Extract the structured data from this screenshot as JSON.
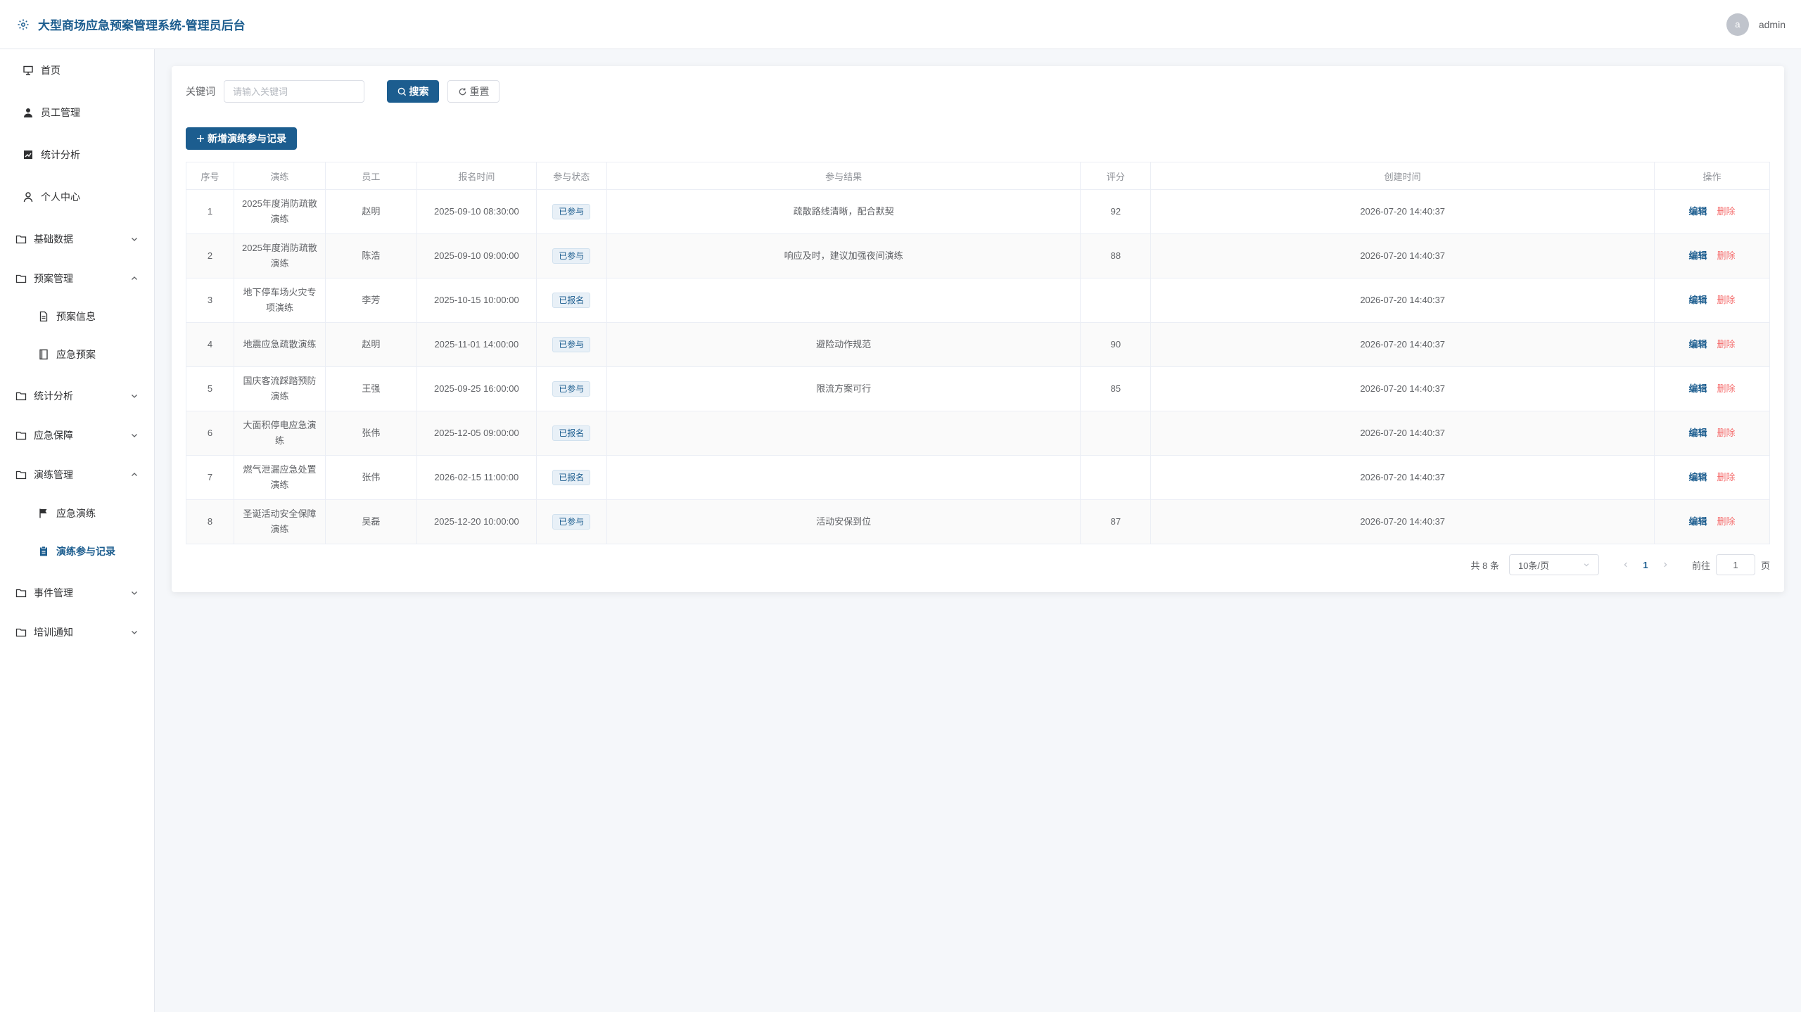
{
  "header": {
    "title": "大型商场应急预案管理系统-管理员后台",
    "avatar_letter": "a",
    "username": "admin"
  },
  "sidebar": {
    "items": [
      {
        "label": "首页",
        "icon": "presentation-icon",
        "type": "item"
      },
      {
        "label": "员工管理",
        "icon": "user-filled-icon",
        "type": "item"
      },
      {
        "label": "统计分析",
        "icon": "chart-icon",
        "type": "item"
      },
      {
        "label": "个人中心",
        "icon": "user-icon",
        "type": "item"
      },
      {
        "label": "基础数据",
        "icon": "folder-icon",
        "type": "group",
        "expanded": false
      },
      {
        "label": "预案管理",
        "icon": "folder-icon",
        "type": "group",
        "expanded": true
      },
      {
        "label": "预案信息",
        "icon": "document-icon",
        "type": "sub"
      },
      {
        "label": "应急预案",
        "icon": "notebook-icon",
        "type": "sub"
      },
      {
        "label": "统计分析",
        "icon": "folder-icon",
        "type": "group",
        "expanded": false
      },
      {
        "label": "应急保障",
        "icon": "folder-icon",
        "type": "group",
        "expanded": false
      },
      {
        "label": "演练管理",
        "icon": "folder-icon",
        "type": "group",
        "expanded": true
      },
      {
        "label": "应急演练",
        "icon": "flag-icon",
        "type": "sub"
      },
      {
        "label": "演练参与记录",
        "icon": "clipboard-icon",
        "type": "sub",
        "active": true
      },
      {
        "label": "事件管理",
        "icon": "folder-icon",
        "type": "group",
        "expanded": false
      },
      {
        "label": "培训通知",
        "icon": "folder-icon",
        "type": "group",
        "expanded": false
      }
    ]
  },
  "search": {
    "label": "关键词",
    "placeholder": "请输入关键词",
    "search_button": "搜索",
    "reset_button": "重置"
  },
  "toolbar": {
    "add_button": "新增演练参与记录"
  },
  "table": {
    "columns": [
      "序号",
      "演练",
      "员工",
      "报名时间",
      "参与状态",
      "参与结果",
      "评分",
      "创建时间",
      "操作"
    ],
    "rows": [
      {
        "no": "1",
        "drill": "2025年度消防疏散演练",
        "employee": "赵明",
        "signup_time": "2025-09-10 08:30:00",
        "status": "已参与",
        "result": "疏散路线清晰，配合默契",
        "score": "92",
        "created": "2026-07-20 14:40:37"
      },
      {
        "no": "2",
        "drill": "2025年度消防疏散演练",
        "employee": "陈浩",
        "signup_time": "2025-09-10 09:00:00",
        "status": "已参与",
        "result": "响应及时，建议加强夜间演练",
        "score": "88",
        "created": "2026-07-20 14:40:37"
      },
      {
        "no": "3",
        "drill": "地下停车场火灾专项演练",
        "employee": "李芳",
        "signup_time": "2025-10-15 10:00:00",
        "status": "已报名",
        "result": "",
        "score": "",
        "created": "2026-07-20 14:40:37"
      },
      {
        "no": "4",
        "drill": "地震应急疏散演练",
        "employee": "赵明",
        "signup_time": "2025-11-01 14:00:00",
        "status": "已参与",
        "result": "避险动作规范",
        "score": "90",
        "created": "2026-07-20 14:40:37"
      },
      {
        "no": "5",
        "drill": "国庆客流踩踏预防演练",
        "employee": "王强",
        "signup_time": "2025-09-25 16:00:00",
        "status": "已参与",
        "result": "限流方案可行",
        "score": "85",
        "created": "2026-07-20 14:40:37"
      },
      {
        "no": "6",
        "drill": "大面积停电应急演练",
        "employee": "张伟",
        "signup_time": "2025-12-05 09:00:00",
        "status": "已报名",
        "result": "",
        "score": "",
        "created": "2026-07-20 14:40:37"
      },
      {
        "no": "7",
        "drill": "燃气泄漏应急处置演练",
        "employee": "张伟",
        "signup_time": "2026-02-15 11:00:00",
        "status": "已报名",
        "result": "",
        "score": "",
        "created": "2026-07-20 14:40:37"
      },
      {
        "no": "8",
        "drill": "圣诞活动安全保障演练",
        "employee": "吴磊",
        "signup_time": "2025-12-20 10:00:00",
        "status": "已参与",
        "result": "活动安保到位",
        "score": "87",
        "created": "2026-07-20 14:40:37"
      }
    ],
    "edit_label": "编辑",
    "delete_label": "删除"
  },
  "pagination": {
    "total_text": "共 8 条",
    "page_size": "10条/页",
    "current_page": "1",
    "goto_label": "前往",
    "goto_value": "1",
    "page_suffix": "页"
  },
  "colors": {
    "primary": "#1c5d8f",
    "danger": "#f56c6c",
    "tag_bg": "#e8f0f7"
  }
}
